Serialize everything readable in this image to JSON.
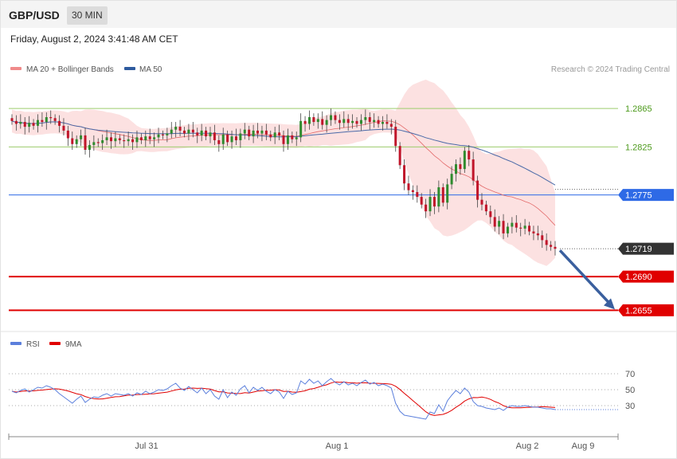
{
  "header": {
    "symbol": "GBP/USD",
    "timeframe": "30 MIN",
    "datetime": "Friday, August 2, 2024 3:41:48 AM CET"
  },
  "legend": {
    "ma20_label": "MA 20 + Bollinger Bands",
    "ma50_label": "MA 50",
    "credit": "Research © 2024 Trading Central",
    "rsi_label": "RSI",
    "rsi_ma_label": "9MA"
  },
  "colors": {
    "bullish": "#2e8b2e",
    "bearish": "#c0152a",
    "bollinger_fill": "#fcdcdc",
    "ma20": "#e36a6a",
    "ma50": "#4a6aa8",
    "resistance_green": "#9ccc6c",
    "pivot_blue": "#2e6ae6",
    "support_red": "#e00000",
    "rsi": "#5b7fdc",
    "rsi_ma": "#e00000",
    "arrow": "#3a5f9e",
    "last_price": "#333333"
  },
  "chart_data": {
    "type": "candlestick",
    "price_range": [
      1.2642,
      1.2895
    ],
    "levels": [
      {
        "value": 1.2865,
        "label": "1.2865",
        "kind": "resistance"
      },
      {
        "value": 1.2825,
        "label": "1.2825",
        "kind": "resistance"
      },
      {
        "value": 1.2775,
        "label": "1.2775",
        "kind": "pivot"
      },
      {
        "value": 1.2719,
        "label": "1.2719",
        "kind": "last"
      },
      {
        "value": 1.269,
        "label": "1.2690",
        "kind": "support"
      },
      {
        "value": 1.2655,
        "label": "1.2655",
        "kind": "support"
      }
    ],
    "x_labels": [
      "Jul 31",
      "Aug 1",
      "Aug 2",
      "Aug 9"
    ],
    "close": [
      1.2852,
      1.2849,
      1.2851,
      1.2846,
      1.285,
      1.2847,
      1.2853,
      1.2851,
      1.2856,
      1.2855,
      1.2852,
      1.2847,
      1.2842,
      1.2834,
      1.2828,
      1.2833,
      1.2837,
      1.2822,
      1.2827,
      1.283,
      1.2829,
      1.2832,
      1.2835,
      1.2831,
      1.2834,
      1.2832,
      1.2831,
      1.2833,
      1.283,
      1.2835,
      1.2832,
      1.2836,
      1.2833,
      1.2835,
      1.2838,
      1.2837,
      1.2839,
      1.2843,
      1.2846,
      1.2842,
      1.2839,
      1.2843,
      1.284,
      1.2837,
      1.2842,
      1.2836,
      1.284,
      1.2832,
      1.2828,
      1.2838,
      1.283,
      1.2836,
      1.2832,
      1.2839,
      1.2843,
      1.2836,
      1.2842,
      1.2839,
      1.2842,
      1.2838,
      1.2835,
      1.284,
      1.2837,
      1.2828,
      1.2837,
      1.2833,
      1.2835,
      1.2852,
      1.2849,
      1.2856,
      1.2851,
      1.2854,
      1.2848,
      1.2853,
      1.2858,
      1.2853,
      1.285,
      1.2854,
      1.285,
      1.2852,
      1.2849,
      1.2853,
      1.2856,
      1.2851,
      1.2853,
      1.2849,
      1.2851,
      1.2849,
      1.2846,
      1.2826,
      1.2806,
      1.2787,
      1.278,
      1.2778,
      1.2773,
      1.2765,
      1.2758,
      1.2773,
      1.2763,
      1.2783,
      1.2767,
      1.2786,
      1.2797,
      1.2807,
      1.2802,
      1.2821,
      1.2812,
      1.279,
      1.277,
      1.2765,
      1.2758,
      1.2752,
      1.2742,
      1.2748,
      1.2735,
      1.2742,
      1.2746,
      1.2741,
      1.274,
      1.2743,
      1.2737,
      1.2735,
      1.2733,
      1.2728,
      1.2723,
      1.2721,
      1.2719
    ],
    "rsi": [
      48,
      46,
      49,
      51,
      47,
      50,
      53,
      52,
      55,
      53,
      50,
      45,
      41,
      37,
      33,
      38,
      42,
      34,
      38,
      41,
      40,
      43,
      45,
      42,
      45,
      44,
      43,
      45,
      42,
      46,
      44,
      48,
      45,
      47,
      50,
      49,
      51,
      55,
      58,
      52,
      49,
      54,
      50,
      46,
      52,
      45,
      50,
      42,
      38,
      50,
      40,
      47,
      43,
      51,
      55,
      46,
      53,
      49,
      53,
      48,
      45,
      50,
      47,
      39,
      48,
      44,
      46,
      61,
      57,
      63,
      58,
      61,
      55,
      60,
      64,
      59,
      56,
      60,
      56,
      58,
      55,
      59,
      62,
      57,
      59,
      55,
      57,
      55,
      52,
      33,
      23,
      18,
      17,
      16,
      15,
      14,
      13,
      22,
      20,
      31,
      23,
      36,
      43,
      49,
      45,
      52,
      47,
      35,
      30,
      29,
      27,
      26,
      25,
      27,
      24,
      28,
      30,
      29,
      29,
      30,
      29,
      28,
      28,
      27,
      26,
      26,
      25
    ],
    "rsi_levels": [
      70,
      50,
      30
    ]
  }
}
